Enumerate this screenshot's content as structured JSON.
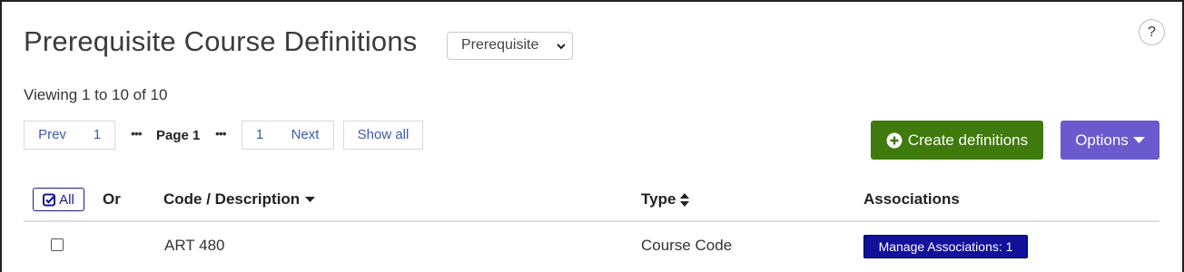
{
  "header": {
    "title": "Prerequisite Course Definitions",
    "type_select": {
      "value": "Prerequisite"
    },
    "help_label": "?"
  },
  "pagination": {
    "viewing": "Viewing 1 to 10 of 10",
    "prev": "Prev",
    "first_page": "1",
    "current": "Page 1",
    "last_page": "1",
    "next": "Next",
    "show_all": "Show all",
    "ellipsis": "•••"
  },
  "actions": {
    "create": "Create definitions",
    "options": "Options"
  },
  "table": {
    "select_all": "All",
    "columns": [
      "Or",
      "Code / Description",
      "Type",
      "Associations"
    ],
    "rows": [
      {
        "code": "ART 480",
        "type": "Course Code",
        "associations": "Manage Associations: 1"
      }
    ]
  },
  "colors": {
    "create_bg": "#3f7a0c",
    "options_bg": "#6a5acd",
    "assoc_bg": "#11119a",
    "link": "#3d5aa8"
  }
}
